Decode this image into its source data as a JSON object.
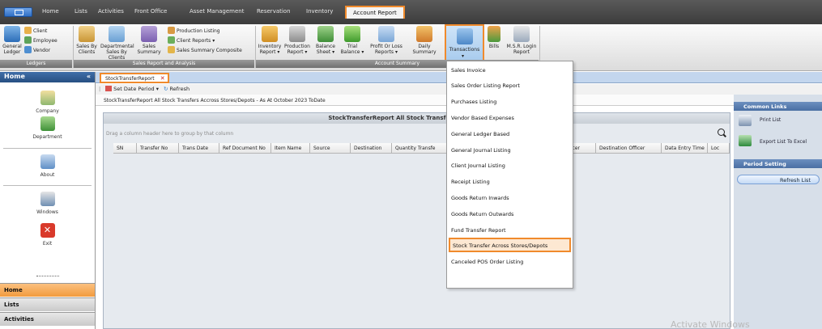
{
  "menubar": {
    "tabs": [
      "Home",
      "Lists",
      "Activities",
      "Front Office",
      "Asset Management",
      "Reservation",
      "Inventory",
      "Account Report"
    ],
    "active_tab": "Account Report"
  },
  "ribbon": {
    "ledger": {
      "general_ledger": "General Ledger",
      "client": "Client",
      "employee": "Employee",
      "vendor": "Vendor"
    },
    "sales": {
      "sales_by_clients": "Sales By Clients",
      "departmental": "Departmental",
      "sales_by_clients_2": "Sales By Clients",
      "sales_summary": "Sales Summary",
      "production_listing": "Production Listing",
      "client_reports": "Client Reports",
      "sales_summary_composite": "Sales Summary Composite"
    },
    "account": {
      "inventory_report": "Inventory Report",
      "production_report": "Production Report",
      "balance_sheet": "Balance Sheet",
      "trial_balance": "Trial Balance",
      "profit_or_loss": "Profit Or Loss Reports",
      "daily_summary": "Daily Summary",
      "transactions": "Transactions",
      "bills": "Bills",
      "msr_login": "M.S.R. Login Report"
    },
    "groups": {
      "ledgers": "Ledgers",
      "sales_report_analysis": "Sales Report and Analysis",
      "account_summary": "Account Summary"
    }
  },
  "sidebar": {
    "header": "Home",
    "items": [
      "Company",
      "Department",
      "About",
      "Windows",
      "Exit"
    ],
    "nav_buttons": [
      "Home",
      "Lists",
      "Activities"
    ]
  },
  "doc_tab": {
    "label": "StockTransferReport"
  },
  "toolbar": {
    "set_date_period": "Set Date Period",
    "refresh": "Refresh"
  },
  "report_path": "StockTransferReport All Stock Transfers Accross Stores/Depots - As At October 2023 ToDate",
  "grid": {
    "title": "StockTransferReport All Stock Transfers Accross Stores",
    "group_hint": "Drag a column header here to group by that column",
    "columns": [
      "SN",
      "Transfer No",
      "Trans Date",
      "Ref Document No",
      "Item Name",
      "Source",
      "Destination",
      "Quantity Transfe",
      "",
      "Officer",
      "Destination Officer",
      "Data Entry Time",
      "Loc"
    ]
  },
  "right_panel": {
    "common_links": "Common Links",
    "print_list": "Print List",
    "export_excel": "Export List To Excel",
    "period_setting": "Period Setting",
    "refresh_list": "Refresh List"
  },
  "dropdown": {
    "items": [
      "Sales Invoice",
      "Sales Order Listing Report",
      "Purchases Listing",
      "Vendor Based Expenses",
      "General Ledger Based",
      "General Journal Listing",
      "Client Journal Listing",
      "Receipt Listing",
      "Goods Return Inwards",
      "Goods Return Outwards",
      "Fund Transfer Report",
      "Stock Transfer Across Stores/Depots",
      "Canceled POS Order Listing"
    ],
    "selected": "Stock Transfer Across Stores/Depots"
  },
  "watermark": "Activate Windows",
  "colors": {
    "highlight": "#f08a2c",
    "nav_active": "#f29b3e",
    "side_head": "#274f82"
  }
}
